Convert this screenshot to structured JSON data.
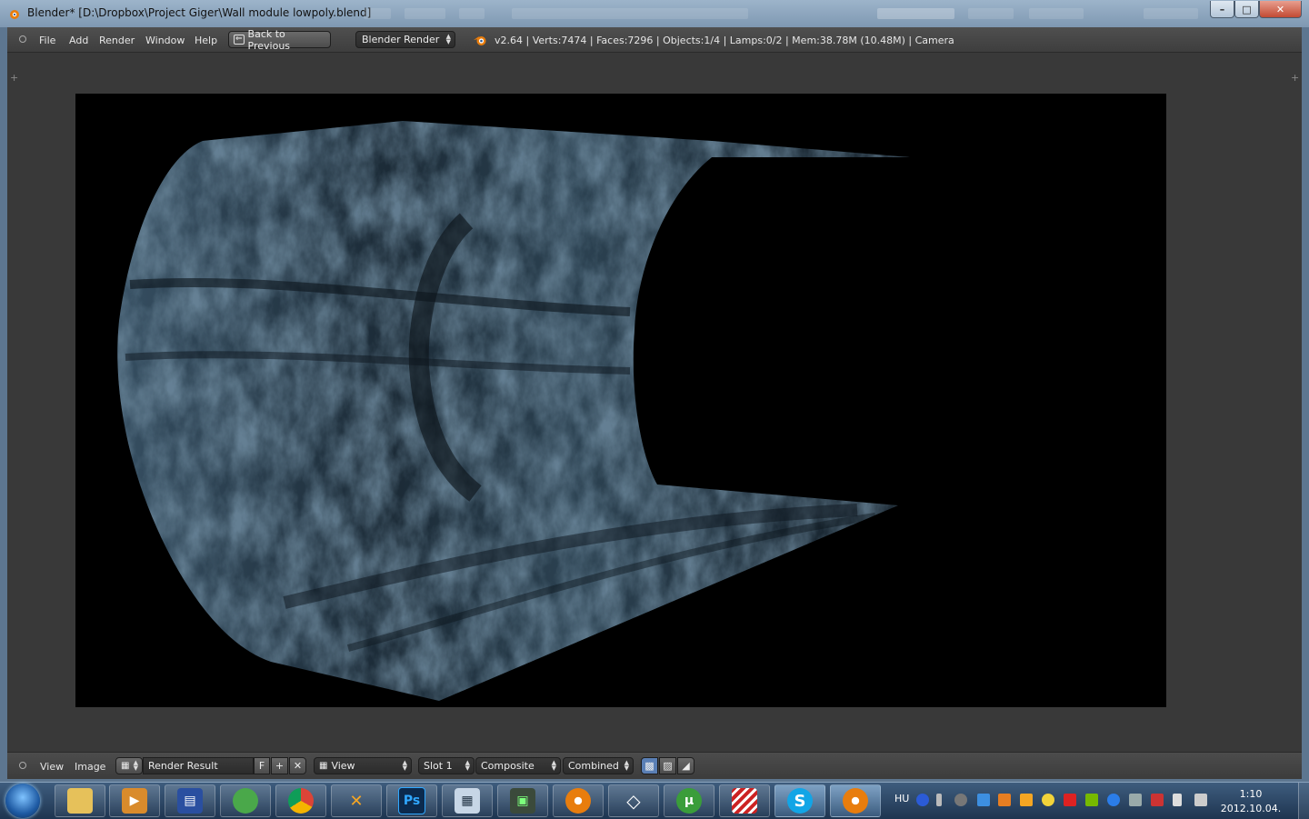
{
  "window": {
    "title": "Blender* [D:\\Dropbox\\Project Giger\\Wall module lowpoly.blend]",
    "minimize_label": "–",
    "maximize_label": "□",
    "close_label": "✕"
  },
  "topbar": {
    "menus": [
      "File",
      "Add",
      "Render",
      "Window",
      "Help"
    ],
    "back_button": "Back to Previous",
    "render_engine": "Blender Render",
    "stats": "v2.64 | Verts:7474 | Faces:7296 | Objects:1/4 | Lamps:0/2 | Mem:38.78M (10.48M) | Camera"
  },
  "bottombar": {
    "menus": [
      "View",
      "Image"
    ],
    "image_name": "Render Result",
    "fake_user": "F",
    "view_mode": "View",
    "slot": "Slot 1",
    "layer": "Composite",
    "pass": "Combined"
  },
  "taskbar": {
    "apps": [
      "windows-explorer",
      "media-player",
      "save-disk",
      "messenger",
      "chrome",
      "cadet",
      "photoshop",
      "calculator",
      "system-monitor",
      "blender",
      "unity",
      "utorrent",
      "stripes-app",
      "skype",
      "blender-active"
    ],
    "photoshop_label": "Ps",
    "language": "HU",
    "time": "1:10",
    "date": "2012.10.04."
  },
  "colors": {
    "blender_bg": "#393939",
    "render_bg": "#000000",
    "texture_tint": "#2e4558"
  }
}
